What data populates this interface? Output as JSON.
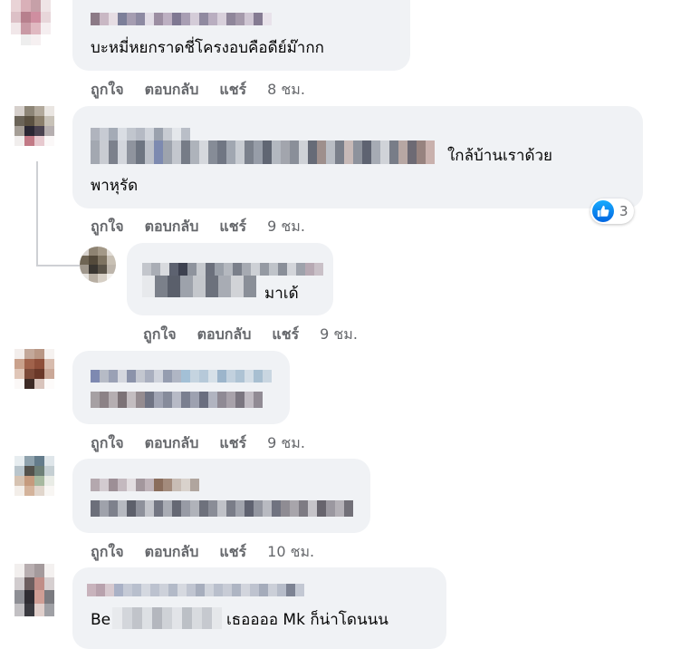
{
  "comments": [
    {
      "text": "บะหมี่หยกราดชี่โครงอบคือดีย์ม๊ากก",
      "actions": {
        "like": "ถูกใจ",
        "reply": "ตอบกลับ",
        "share": "แชร์",
        "time": "8 ชม."
      }
    },
    {
      "text_line1_suffix": "ใกล้บ้านเราด้วย",
      "text_line2": "พาหุรัด",
      "reaction": {
        "icon": "like-icon",
        "count": "3"
      },
      "actions": {
        "like": "ถูกใจ",
        "reply": "ตอบกลับ",
        "share": "แชร์",
        "time": "9 ชม."
      }
    },
    {
      "text_suffix": "มาเด้",
      "actions": {
        "like": "ถูกใจ",
        "reply": "ตอบกลับ",
        "share": "แชร์",
        "time": "9 ชม."
      }
    },
    {
      "actions": {
        "like": "ถูกใจ",
        "reply": "ตอบกลับ",
        "share": "แชร์",
        "time": "9 ชม."
      }
    },
    {
      "actions": {
        "like": "ถูกใจ",
        "reply": "ตอบกลับ",
        "share": "แชร์",
        "time": "10 ชม."
      }
    },
    {
      "text_prefix": "Be",
      "text_suffix": "เธออออ Mk ก็น่าโดนนน"
    }
  ],
  "colors": {
    "bubble": "#f0f2f5",
    "meta": "#65676b",
    "like_blue": "#1877f2"
  }
}
